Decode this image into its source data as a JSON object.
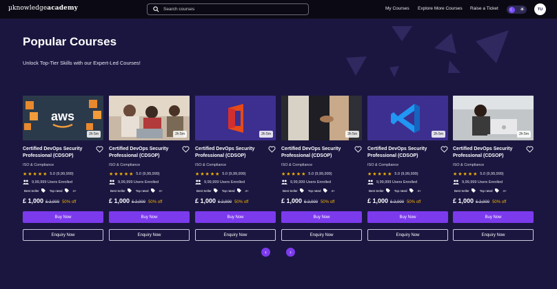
{
  "header": {
    "logo_prefix": "µknowledge",
    "logo_bold": "academy",
    "search_placeholder": "Search courses",
    "nav": [
      "My Courses",
      "Explore More Courses",
      "Raise a Ticket"
    ],
    "avatar_initials": "TU"
  },
  "hero": {
    "title": "Popular Courses",
    "subtitle": "Unlock Top-Tier Skills with our Expert-Led Courses!"
  },
  "accent_color": "#7c3aed",
  "star_color": "#f5b400",
  "cards": [
    {
      "image": "aws-logo",
      "duration": "2h 5m",
      "title": "Certified DevOps Security Professional (CDSOP)",
      "category": "ISO & Compliance",
      "stars": "★★★★★",
      "rating": "5.0 (9,99,999)",
      "enrolled": "9,99,999 Users Enrolled",
      "badge1": "Best Seller",
      "badge2": "Top rated",
      "badge_more": "4+",
      "price": "£ 1,000",
      "old_price": "£ 2,000",
      "discount": "50% off",
      "buy": "Buy Now",
      "enquiry": "Enquiry Now"
    },
    {
      "image": "team-photo",
      "duration": "2h 5m",
      "title": "Certified DevOps Security Professional (CDSOP)",
      "category": "ISO & Compliance",
      "stars": "★★★★★",
      "rating": "5.0 (9,99,999)",
      "enrolled": "9,99,999 Users Enrolled",
      "badge1": "Best Seller",
      "badge2": "Top rated",
      "badge_more": "4+",
      "price": "£ 1,000",
      "old_price": "£ 2,000",
      "discount": "50% off",
      "buy": "Buy Now",
      "enquiry": "Enquiry Now"
    },
    {
      "image": "office-logo",
      "duration": "2h 5m",
      "title": "Certified DevOps Security Professional (CDSOP)",
      "category": "ISO & Compliance",
      "stars": "★★★★★",
      "rating": "5.0 (9,99,999)",
      "enrolled": "9,99,999 Users Enrolled",
      "badge1": "Best Seller",
      "badge2": "Top rated",
      "badge_more": "4+",
      "price": "£ 1,000",
      "old_price": "£ 2,000",
      "discount": "50% off",
      "buy": "Buy Now",
      "enquiry": "Enquiry Now"
    },
    {
      "image": "handshake-photo",
      "duration": "2h 5m",
      "title": "Certified DevOps Security Professional (CDSOP)",
      "category": "ISO & Compliance",
      "stars": "★★★★★",
      "rating": "5.0 (9,99,999)",
      "enrolled": "9,99,999 Users Enrolled",
      "badge1": "Best Seller",
      "badge2": "Top rated",
      "badge_more": "4+",
      "price": "£ 1,000",
      "old_price": "£ 2,000",
      "discount": "50% off",
      "buy": "Buy Now",
      "enquiry": "Enquiry Now"
    },
    {
      "image": "vscode-logo",
      "duration": "2h 5m",
      "title": "Certified DevOps Security Professional (CDSOP)",
      "category": "ISO & Compliance",
      "stars": "★★★★★",
      "rating": "5.0 (9,99,999)",
      "enrolled": "9,99,999 Users Enrolled",
      "badge1": "Best Seller",
      "badge2": "Top rated",
      "badge_more": "4+",
      "price": "£ 1,000",
      "old_price": "£ 2,000",
      "discount": "50% off",
      "buy": "Buy Now",
      "enquiry": "Enquiry Now"
    },
    {
      "image": "laptop-photo",
      "duration": "2h 5m",
      "title": "Certified DevOps Security Professional (CDSOP)",
      "category": "ISO & Compliance",
      "stars": "★★★★★",
      "rating": "5.0 (9,99,999)",
      "enrolled": "9,99,999 Users Enrolled",
      "badge1": "Best Seller",
      "badge2": "Top rated",
      "badge_more": "4+",
      "price": "£ 1,000",
      "old_price": "£ 2,000",
      "discount": "50% off",
      "buy": "Buy Now",
      "enquiry": "Enquiry Now"
    }
  ],
  "pager": {
    "prev": "‹",
    "next": "›"
  }
}
